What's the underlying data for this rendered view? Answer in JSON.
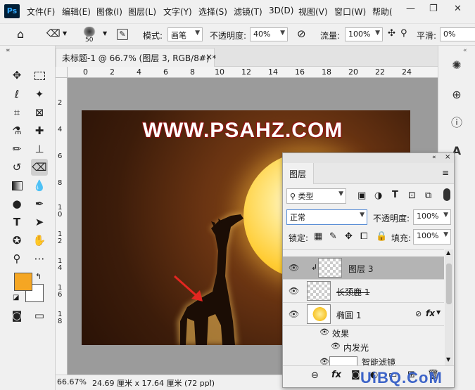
{
  "app": {
    "logo": "Ps"
  },
  "menu": [
    "文件(F)",
    "编辑(E)",
    "图像(I)",
    "图层(L)",
    "文字(Y)",
    "选择(S)",
    "滤镜(T)",
    "3D(D)",
    "视图(V)",
    "窗口(W)",
    "帮助("
  ],
  "window_controls": {
    "minimize": "—",
    "restore": "❐",
    "close": "✕"
  },
  "options": {
    "brush_size": "50",
    "mode_label": "模式:",
    "mode_value": "画笔",
    "opacity_label": "不透明度:",
    "opacity_value": "40%",
    "flow_label": "流量:",
    "flow_value": "100%",
    "smooth_label": "平滑:",
    "smooth_value": "0%"
  },
  "document": {
    "tab_title": "未标题-1 @ 66.7% (图层 3, RGB/8#) *",
    "tab_close": "×",
    "watermark_text": "WWW.PSAHZ.COM"
  },
  "ruler": {
    "h": [
      "0",
      "2",
      "4",
      "6",
      "8",
      "10",
      "12",
      "14",
      "16",
      "18",
      "20",
      "22",
      "24"
    ],
    "v": [
      "2",
      "4",
      "6",
      "8",
      "1\n0",
      "1\n2",
      "1\n4",
      "1\n6",
      "1\n8"
    ]
  },
  "status": {
    "zoom": "66.67%",
    "doc_size": "24.69 厘米 x 17.64 厘米 (72 ppi)"
  },
  "layers_panel": {
    "title": "图层",
    "filter_label": "类型",
    "blend_mode": "正常",
    "opacity_label": "不透明度:",
    "opacity_value": "100%",
    "lock_label": "锁定:",
    "fill_label": "填充:",
    "fill_value": "100%",
    "layers": [
      {
        "name": "图层 3",
        "selected": true,
        "clipped": true
      },
      {
        "name": "长颈鹿 1",
        "strikethrough": true
      },
      {
        "name": "椭圆 1",
        "fx": "fx"
      }
    ],
    "effects_label": "效果",
    "inner_glow_label": "内发光",
    "smart_filter_label": "智能滤镜"
  },
  "colors": {
    "foreground": "#f5a623",
    "background": "#ffffff",
    "selection": "#b4b4b4"
  },
  "bottom_watermark": "UiBQ.CoM"
}
